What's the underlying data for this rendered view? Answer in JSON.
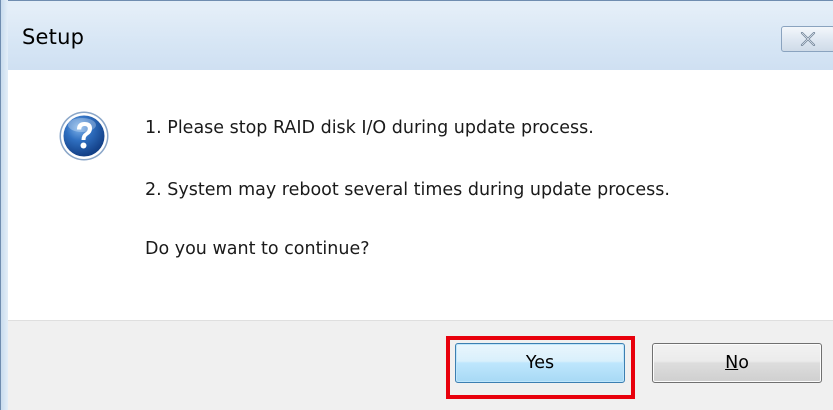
{
  "window": {
    "title": "Setup",
    "close_icon": "close-icon"
  },
  "message": {
    "icon": "question-icon",
    "line1": "1. Please stop RAID disk I/O during update process.",
    "line2": "2. System may reboot several times during update process.",
    "line3": "Do you want to continue?"
  },
  "buttons": {
    "yes_label": "Yes",
    "no_label": "No",
    "highlighted": "Yes"
  },
  "colors": {
    "highlight_border": "#e8000c",
    "icon_blue": "#1f5fb0",
    "titlebar": "#d7e6f5"
  }
}
